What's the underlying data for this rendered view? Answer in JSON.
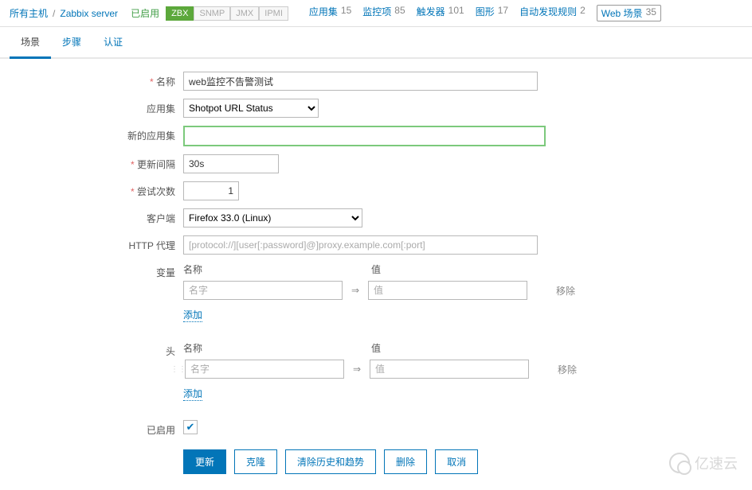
{
  "breadcrumb": {
    "all_hosts": "所有主机",
    "host": "Zabbix server"
  },
  "status": "已启用",
  "badges": {
    "zbx": "ZBX",
    "snmp": "SNMP",
    "jmx": "JMX",
    "ipmi": "IPMI"
  },
  "nav": {
    "apps": {
      "label": "应用集",
      "count": "15"
    },
    "items": {
      "label": "监控项",
      "count": "85"
    },
    "trig": {
      "label": "触发器",
      "count": "101"
    },
    "graphs": {
      "label": "图形",
      "count": "17"
    },
    "disc": {
      "label": "自动发现规则",
      "count": "2"
    },
    "web": {
      "label": "Web 场景",
      "count": "35"
    }
  },
  "tabs": {
    "scenario": "场景",
    "steps": "步骤",
    "auth": "认证"
  },
  "form": {
    "name_label": "名称",
    "name_value": "web监控不告警测试",
    "application_label": "应用集",
    "application_value": "Shotpot URL Status",
    "new_app_label": "新的应用集",
    "new_app_value": "",
    "interval_label": "更新间隔",
    "interval_value": "30s",
    "attempts_label": "尝试次数",
    "attempts_value": "1",
    "agent_label": "客户端",
    "agent_value": "Firefox 33.0 (Linux)",
    "proxy_label": "HTTP 代理",
    "proxy_placeholder": "[protocol://][user[:password]@]proxy.example.com[:port]",
    "vars_label": "变量",
    "headers_label": "头",
    "pair_name_header": "名称",
    "pair_value_header": "值",
    "pair_name_placeholder": "名字",
    "pair_value_placeholder": "值",
    "remove": "移除",
    "add": "添加",
    "enabled_label": "已启用"
  },
  "buttons": {
    "update": "更新",
    "clone": "克隆",
    "clear": "清除历史和趋势",
    "delete": "删除",
    "cancel": "取消"
  },
  "watermark": "亿速云"
}
